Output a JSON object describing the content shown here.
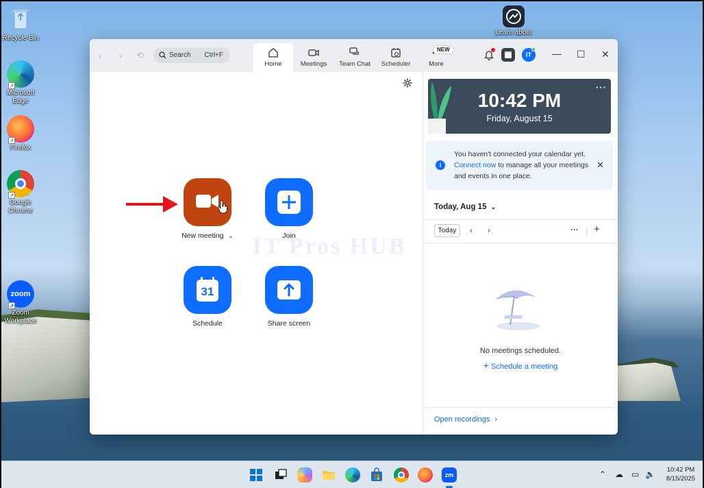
{
  "desktop": {
    "icons": [
      {
        "label": "Recycle Bin"
      },
      {
        "label": "Microsoft Edge"
      },
      {
        "label": "Firefox"
      },
      {
        "label": "Google Chrome"
      },
      {
        "label": "Zoom Workplace"
      },
      {
        "label": "Learn about"
      }
    ]
  },
  "titlebar": {
    "search_label": "Search",
    "search_shortcut": "Ctrl+F",
    "tabs": [
      {
        "label": "Home"
      },
      {
        "label": "Meetings"
      },
      {
        "label": "Team Chat"
      },
      {
        "label": "Scheduler"
      },
      {
        "label": "More"
      }
    ],
    "new_badge": "NEW",
    "avatar_initials": "IT"
  },
  "home": {
    "actions": [
      {
        "label": "New meeting",
        "color": "#c0440f"
      },
      {
        "label": "Join",
        "color": "#0e6cff"
      },
      {
        "label": "Schedule",
        "color": "#0e6cff",
        "glyph": "31"
      },
      {
        "label": "Share screen",
        "color": "#0e6cff"
      }
    ],
    "watermark": "IT Pros HUB"
  },
  "sidebar": {
    "time": "10:42 PM",
    "date": "Friday, August 15",
    "calendar_notice_prefix": "You haven't connected your calendar yet.",
    "calendar_notice_link": "Connect now",
    "calendar_notice_suffix": "to manage all your meetings and events in one place.",
    "today_header": "Today, Aug 15",
    "today_button": "Today",
    "empty_text": "No meetings scheduled.",
    "schedule_link": "Schedule a meeting",
    "open_recordings": "Open recordings"
  },
  "taskbar": {
    "time": "10:42 PM",
    "date": "8/15/2025",
    "zoom_tile_text": "zm"
  },
  "colors": {
    "accent": "#0e6cff",
    "new_meeting": "#c0440f",
    "arrow": "#e8141b"
  }
}
